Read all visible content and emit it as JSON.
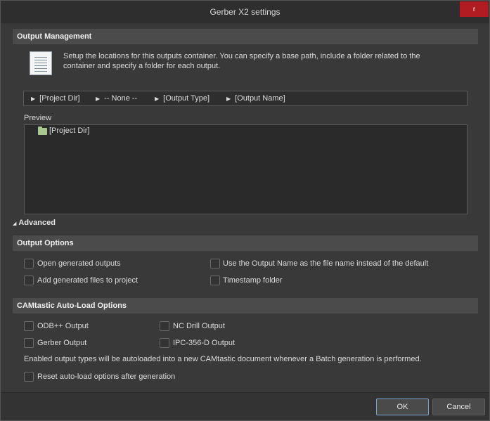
{
  "window": {
    "title": "Gerber X2 settings",
    "close_label": "r"
  },
  "output_management": {
    "header": "Output Management",
    "desc_line1": "Setup the locations for this outputs container. You can specify a base path, include a folder related to the",
    "desc_line2": "container and specify a folder for each output.",
    "path_segments": [
      "[Project Dir]",
      "-- None --",
      "[Output Type]",
      "[Output Name]"
    ],
    "preview_label": "Preview",
    "tree_root": "[Project Dir]",
    "advanced_label": "Advanced"
  },
  "output_options": {
    "header": "Output Options",
    "open_generated": "Open generated outputs",
    "add_generated": "Add generated files to project",
    "use_output_name": "Use the Output Name as the file name instead of the default",
    "timestamp_folder": "Timestamp folder"
  },
  "camtastic": {
    "header": "CAMtastic Auto-Load Options",
    "odb": "ODB++ Output",
    "gerber": "Gerber Output",
    "nc_drill": "NC Drill Output",
    "ipc": "IPC-356-D Output",
    "note": "Enabled output types will be autoloaded into a new CAMtastic  document whenever a Batch generation is performed.",
    "reset": "Reset auto-load options after generation"
  },
  "footer": {
    "ok_label": "OK",
    "cancel_label": "Cancel"
  },
  "colors": {
    "close_button": "#b01c22",
    "section_header": "#4b4b4b",
    "folder": "#a8c890",
    "ok_border": "#7aa4d6"
  }
}
